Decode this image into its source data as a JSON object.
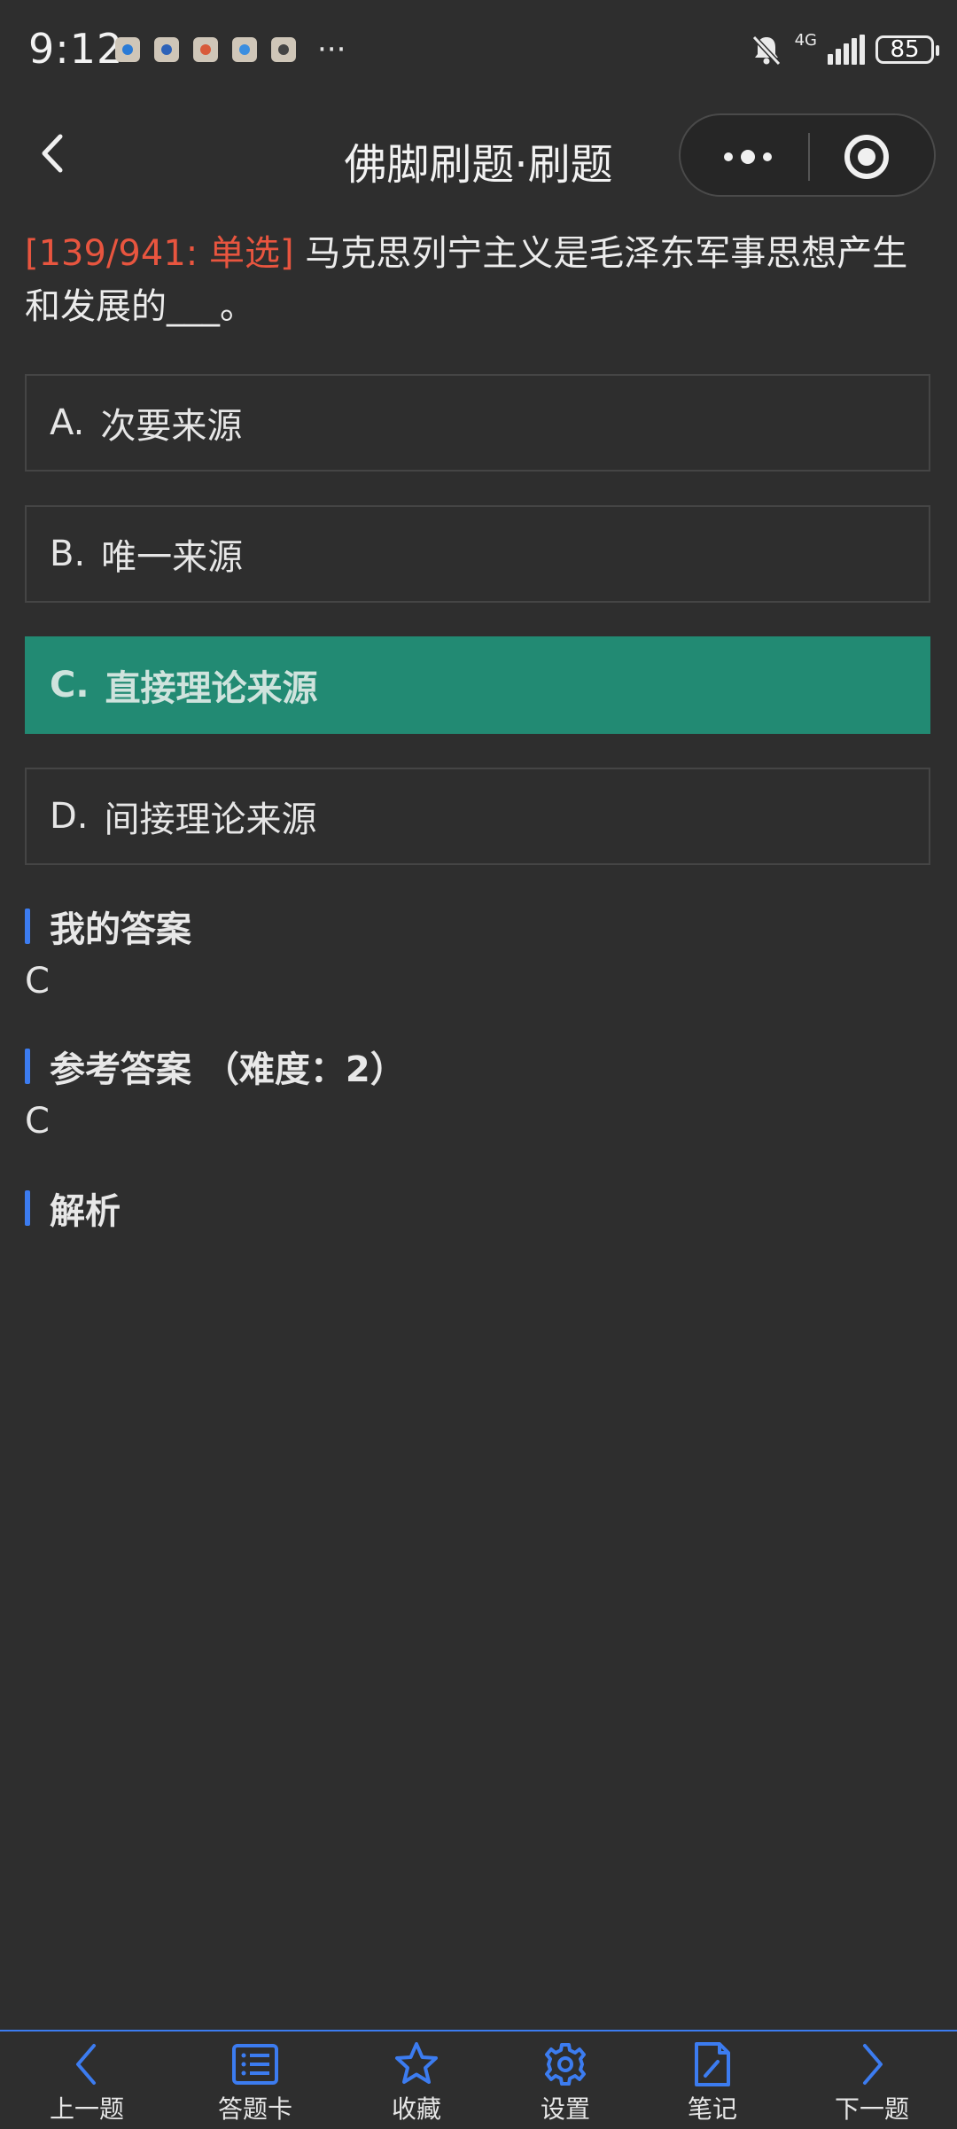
{
  "status_bar": {
    "time": "9:12",
    "more": "···",
    "network": "4G",
    "battery": "85"
  },
  "nav": {
    "title": "佛脚刷题·刷题"
  },
  "question": {
    "tag": "[139/941: 单选]",
    "text": " 马克思列宁主义是毛泽东军事思想产生和发展的___。"
  },
  "options": [
    {
      "letter": "A.",
      "text": "次要来源",
      "selected": false
    },
    {
      "letter": "B.",
      "text": "唯一来源",
      "selected": false
    },
    {
      "letter": "C.",
      "text": "直接理论来源",
      "selected": true
    },
    {
      "letter": "D.",
      "text": "间接理论来源",
      "selected": false
    }
  ],
  "my_answer": {
    "title": "我的答案",
    "value": "C"
  },
  "reference_answer": {
    "title": "参考答案 （难度：2）",
    "value": "C"
  },
  "analysis": {
    "title": "解析"
  },
  "toolbar": {
    "accent": "#3c7cf0",
    "items": [
      {
        "label": "上一题",
        "icon": "chevron-left-icon"
      },
      {
        "label": "答题卡",
        "icon": "list-card-icon"
      },
      {
        "label": "收藏",
        "icon": "star-icon"
      },
      {
        "label": "设置",
        "icon": "gear-icon"
      },
      {
        "label": "笔记",
        "icon": "note-edit-icon"
      },
      {
        "label": "下一题",
        "icon": "chevron-right-icon"
      }
    ]
  },
  "colors": {
    "background": "#2e2e2e",
    "selected_option": "#228a73",
    "question_tag": "#e8553f",
    "section_bar": "#3c7cf0"
  }
}
